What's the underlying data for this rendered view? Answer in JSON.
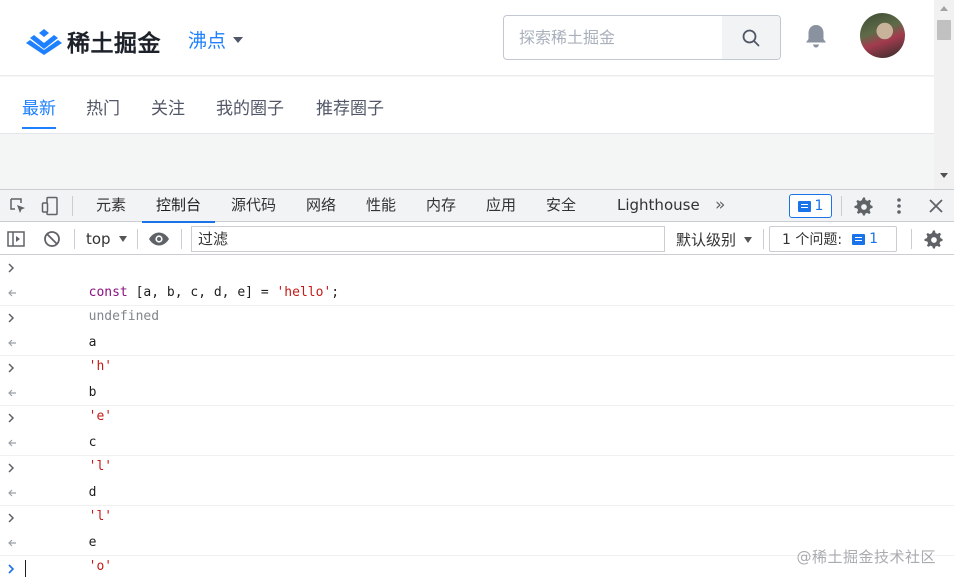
{
  "site": {
    "logo_text": "稀土掘金",
    "nav_menu_label": "沸点",
    "search_placeholder": "探索稀土掘金",
    "tabs": [
      {
        "label": "最新",
        "active": true
      },
      {
        "label": "热门",
        "active": false
      },
      {
        "label": "关注",
        "active": false
      },
      {
        "label": "我的圈子",
        "active": false
      },
      {
        "label": "推荐圈子",
        "active": false
      }
    ],
    "accent_color": "#1e80ff"
  },
  "devtools": {
    "tabs": [
      "元素",
      "控制台",
      "源代码",
      "网络",
      "性能",
      "内存",
      "应用",
      "安全",
      "Lighthouse"
    ],
    "active_tab": "控制台",
    "more_tabs_icon": "»",
    "issues_badge": "1",
    "toolbar": {
      "context": "top",
      "filter_placeholder": "过滤",
      "levels_label": "默认级别",
      "issues_label": "1 个问题:",
      "issues_count": "1"
    },
    "accent_color": "#1a73e8"
  },
  "console": {
    "entries": [
      {
        "input": {
          "kw": "const",
          "rest": " [a, b, c, d, e] = ",
          "str": "'hello'",
          "end": ";"
        },
        "result": "undefined",
        "result_type": "undefined"
      },
      {
        "input": {
          "plain": "a"
        },
        "result": "'h'",
        "result_type": "string"
      },
      {
        "input": {
          "plain": "b"
        },
        "result": "'e'",
        "result_type": "string"
      },
      {
        "input": {
          "plain": "c"
        },
        "result": "'l'",
        "result_type": "string"
      },
      {
        "input": {
          "plain": "d"
        },
        "result": "'l'",
        "result_type": "string"
      },
      {
        "input": {
          "plain": "e"
        },
        "result": "'o'",
        "result_type": "string"
      }
    ]
  },
  "watermark": "@稀土掘金技术社区"
}
